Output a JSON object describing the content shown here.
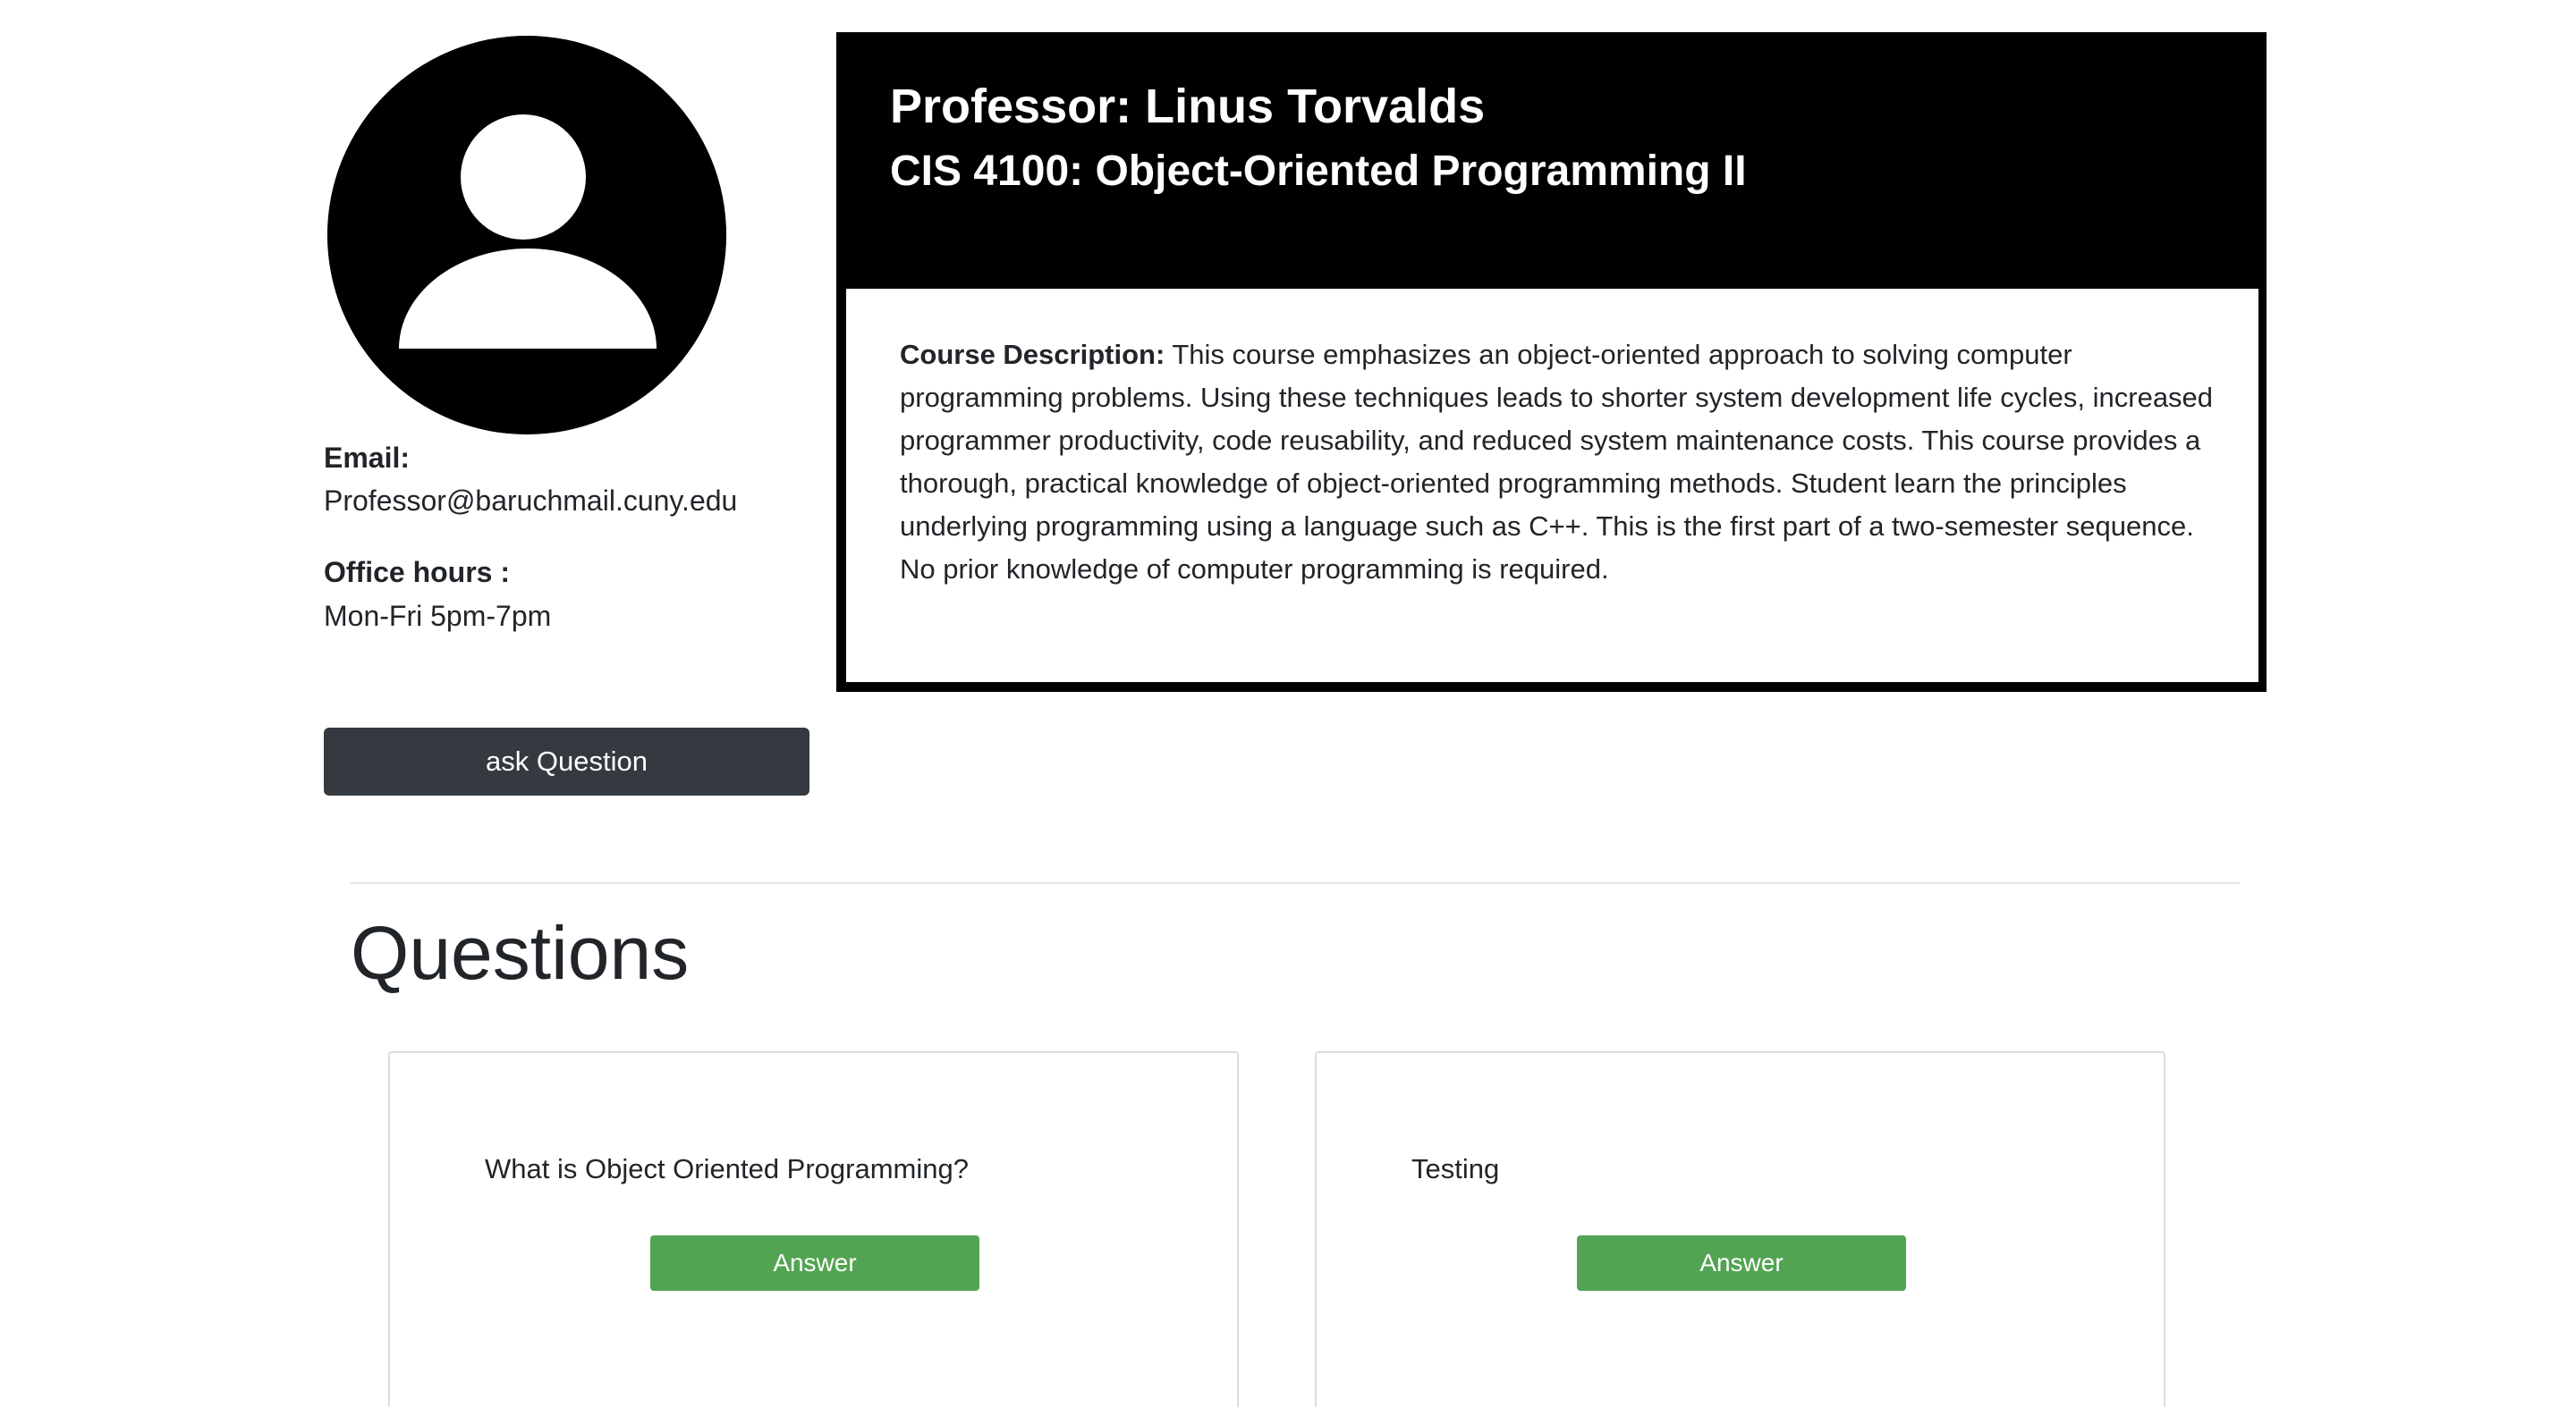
{
  "professor": {
    "title": "Professor: Linus Torvalds",
    "course": "CIS 4100: Object-Oriented Programming II",
    "email_label": "Email:",
    "email": "Professor@baruchmail.cuny.edu",
    "office_hours_label": "Office hours :",
    "office_hours": "Mon-Fri 5pm-7pm",
    "avatar_icon": "user-avatar-icon"
  },
  "course_description": {
    "label": "Course Description:",
    "text": "This course emphasizes an object-oriented approach to solving computer programming problems. Using these techniques leads to shorter system development life cycles, increased programmer productivity, code reusability, and reduced system maintenance costs. This course provides a thorough, practical knowledge of object-oriented programming methods. Student learn the principles underlying programming using a language such as C++. This is the first part of a two-semester sequence. No prior knowledge of computer programming is required."
  },
  "actions": {
    "ask_label": "ask Question"
  },
  "questions_section": {
    "title": "Questions",
    "items": [
      {
        "text": "What is Object Oriented Programming?",
        "answer_label": "Answer"
      },
      {
        "text": "Testing",
        "answer_label": "Answer"
      }
    ]
  },
  "colors": {
    "header_bg": "#000000",
    "ask_button": "#343a40",
    "answer_button": "#52a452"
  }
}
